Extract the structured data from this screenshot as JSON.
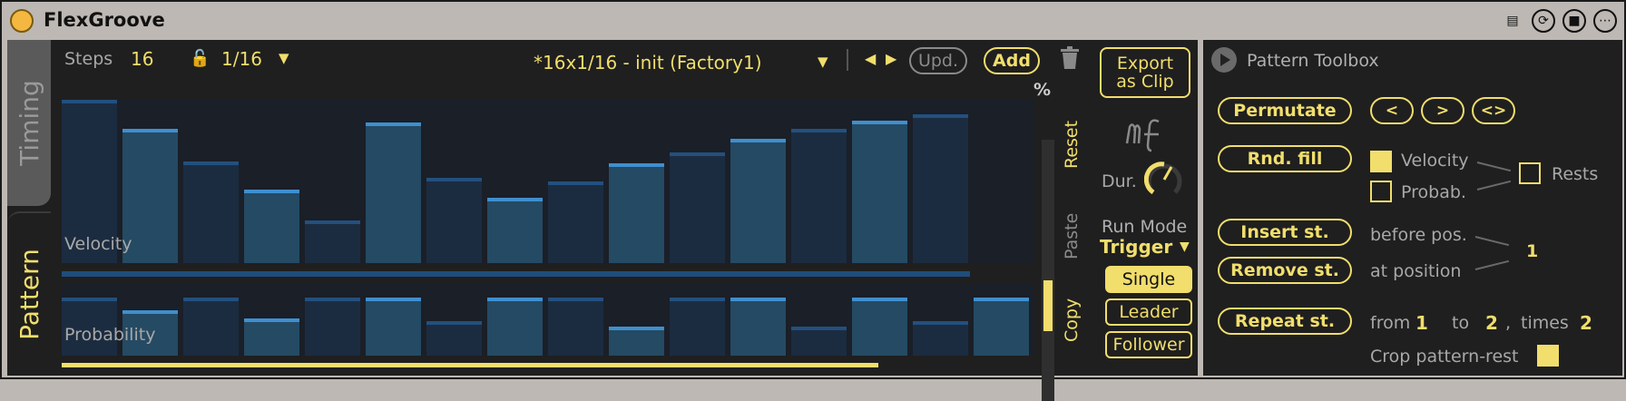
{
  "title": "FlexGroove",
  "tabs": {
    "timing": "Timing",
    "pattern": "Pattern"
  },
  "header": {
    "steps_label": "Steps",
    "steps_value": "16",
    "division": "1/16",
    "preset_name": "*16x1/16 - init (Factory1)",
    "upd": "Upd.",
    "add": "Add",
    "percent": "%"
  },
  "lanes": {
    "velocity": "Velocity",
    "probability": "Probability"
  },
  "edit_buttons": {
    "reset": "Reset",
    "paste": "Paste",
    "copy": "Copy"
  },
  "side": {
    "export": "Export as Clip",
    "dur_label": "Dur.",
    "run_mode_label": "Run Mode",
    "run_mode_value": "Trigger",
    "modes": [
      "Single",
      "Leader",
      "Follower"
    ]
  },
  "toolbox": {
    "title": "Pattern Toolbox",
    "permutate": "Permutate",
    "nav": [
      "<",
      ">",
      "<>"
    ],
    "rnd_fill": "Rnd. fill",
    "velocity": "Velocity",
    "probab": "Probab.",
    "rests": "Rests",
    "insert": "Insert st.",
    "remove": "Remove st.",
    "before_pos": "before pos.",
    "at_position": "at position",
    "position_value": "1",
    "repeat": "Repeat st.",
    "from_label": "from",
    "from_value": "1",
    "to_label": "to",
    "to_value": "2",
    "comma": ",",
    "times_label": "times",
    "times_value": "2",
    "crop": "Crop pattern-rest"
  },
  "velocity_steps": [
    1.0,
    0.82,
    0.62,
    0.45,
    0.26,
    0.86,
    0.52,
    0.4,
    0.5,
    0.61,
    0.68,
    0.76,
    0.82,
    0.87,
    0.91,
    0
  ],
  "probability_steps": [
    0.8,
    0.63,
    0.8,
    0.51,
    0.8,
    0.8,
    0.47,
    0.8,
    0.8,
    0.4,
    0.8,
    0.8,
    0.4,
    0.8,
    0.47,
    0.8
  ],
  "colors": {
    "accent": "#f1de6c",
    "bar": "#254a63",
    "cap": "#3f8fcf"
  }
}
